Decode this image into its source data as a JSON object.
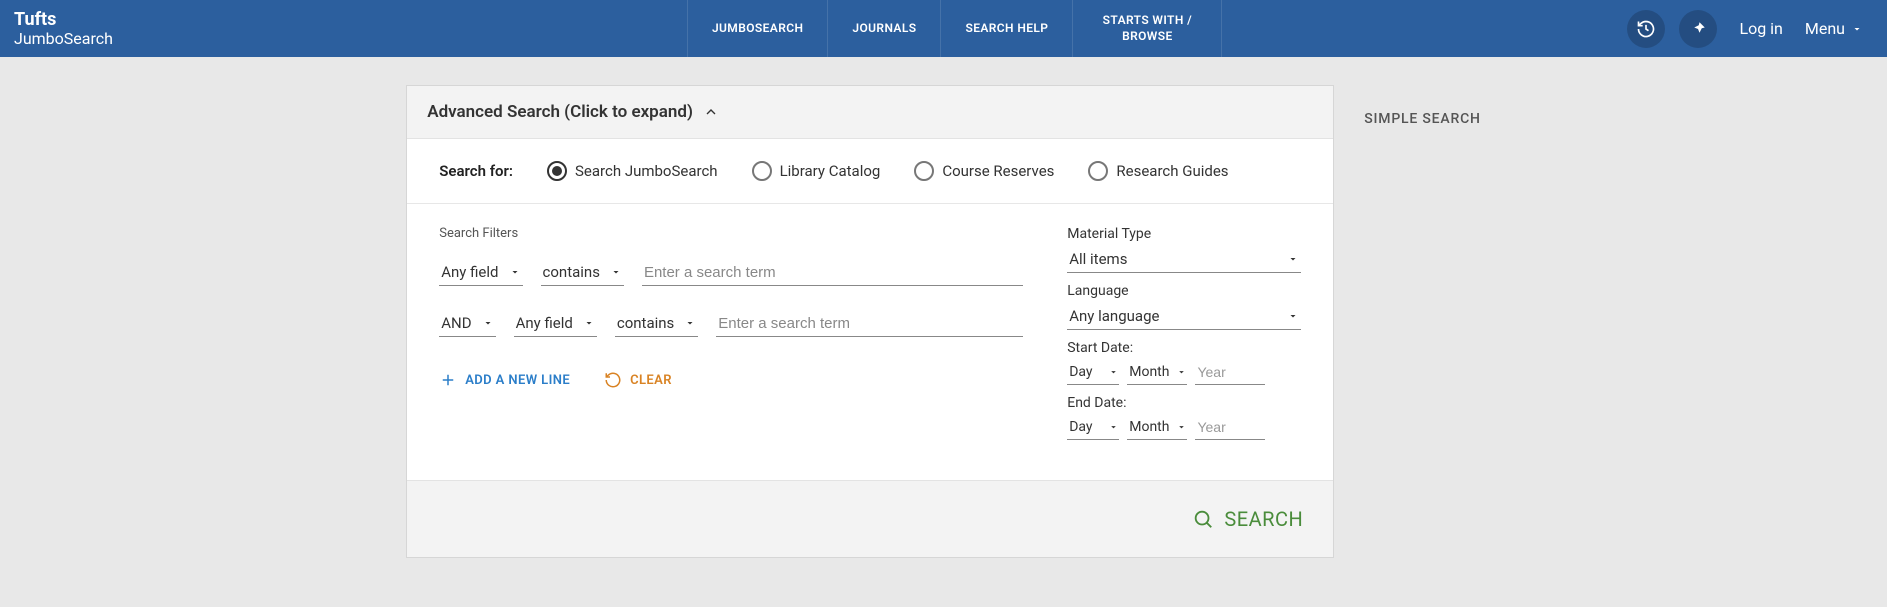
{
  "brand": {
    "top": "Tufts",
    "sub": "JumboSearch"
  },
  "nav": {
    "jumbosearch": "JUMBOSEARCH",
    "journals": "JOURNALS",
    "search_help": "SEARCH HELP",
    "starts_with": "STARTS WITH / BROWSE"
  },
  "header_right": {
    "login": "Log in",
    "menu": "Menu"
  },
  "card": {
    "title": "Advanced Search (Click to expand)",
    "search_for_label": "Search for:",
    "scopes": {
      "jumbo": "Search JumboSearch",
      "catalog": "Library Catalog",
      "reserves": "Course Reserves",
      "guides": "Research Guides"
    },
    "filters_title": "Search Filters",
    "rows": [
      {
        "field": "Any field",
        "op": "contains",
        "placeholder": "Enter a search term"
      },
      {
        "bool": "AND",
        "field": "Any field",
        "op": "contains",
        "placeholder": "Enter a search term"
      }
    ],
    "add_line": "ADD A NEW LINE",
    "clear": "CLEAR",
    "right": {
      "material_type_label": "Material Type",
      "material_type_value": "All items",
      "language_label": "Language",
      "language_value": "Any language",
      "start_date_label": "Start Date:",
      "end_date_label": "End Date:",
      "day": "Day",
      "month": "Month",
      "year_placeholder": "Year"
    },
    "search_button": "SEARCH"
  },
  "side": {
    "simple_search": "SIMPLE SEARCH"
  }
}
